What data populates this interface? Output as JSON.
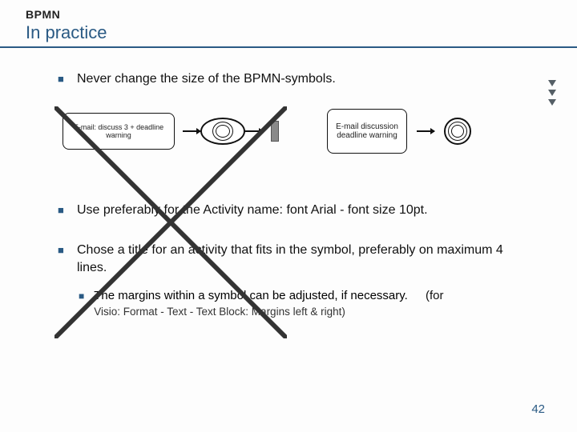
{
  "header": {
    "kicker": "BPMN",
    "title": "In practice"
  },
  "bullets": {
    "b1": "Never change the size of the BPMN-symbols.",
    "b2": "Use preferably for the Activity name: font Arial - font size 10pt.",
    "b3": "Chose a title for an activity that fits in the symbol, preferably on maximum 4 lines.",
    "sub1_main": "The margins within a symbol can be adjusted, if necessary.",
    "sub1_for": "(for",
    "sub1_detail": "Visio: Format - Text - Text Block: Margins left & right)"
  },
  "diagram": {
    "wrong_task_label": "E-mail: discuss 3 + deadline warning",
    "right_task_label": "E-mail discussion deadline warning"
  },
  "pageNumber": "42"
}
